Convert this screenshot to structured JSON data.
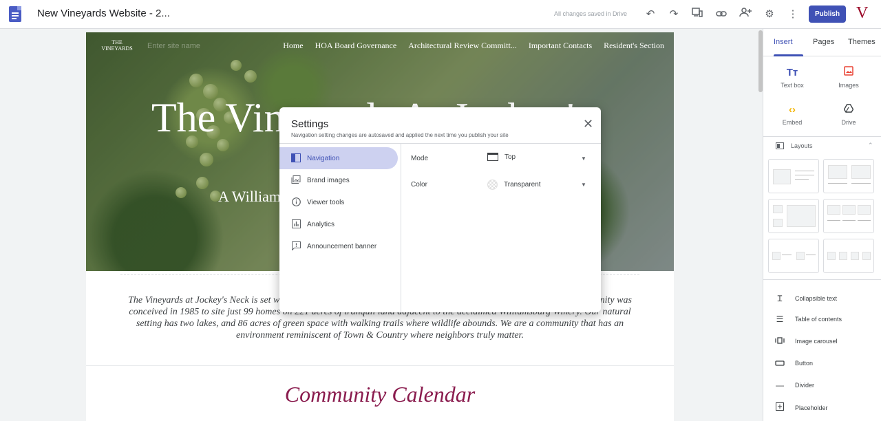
{
  "header": {
    "doc_title": "New Vineyards Website - 2...",
    "save_status": "All changes saved in Drive",
    "publish_label": "Publish",
    "account_initial": "V",
    "icons": [
      "undo-icon",
      "redo-icon",
      "preview-icon",
      "link-icon",
      "share-icon",
      "settings-icon",
      "more-icon"
    ]
  },
  "site": {
    "logo_text": "THE VINEYARDS",
    "name_placeholder": "Enter site name",
    "nav": [
      "Home",
      "HOA Board Governance",
      "Architectural Review Committ...",
      "Important Contacts",
      "Resident's Section"
    ],
    "hero_title": "The Vineyards At Jockey's",
    "hero_subtitle": "A Williamsburg Community",
    "intro": "The Vineyards at Jockey's Neck is set within a short distance from the restored area of Colonial Williamsburg. Our community was conceived in 1985 to site just 99 homes on 221 acres of tranquil land adjacent to the acclaimed Williamsburg Winery. Our natural setting has two lakes, and 86 acres of green space with walking trails where wildlife abounds. We are a community that has an environment reminiscent of Town & Country where neighbors truly matter.",
    "section_title": "Community Calendar"
  },
  "panel": {
    "tabs": [
      "Insert",
      "Pages",
      "Themes"
    ],
    "insert_items": [
      {
        "label": "Text box",
        "icon": "text-box-icon",
        "color": "#3f51b5"
      },
      {
        "label": "Images",
        "icon": "image-icon",
        "color": "#ea4335"
      },
      {
        "label": "Embed",
        "icon": "embed-icon",
        "color": "#f4b400"
      },
      {
        "label": "Drive",
        "icon": "drive-icon",
        "color": "#3c4043"
      }
    ],
    "layouts_label": "Layouts",
    "components": [
      {
        "label": "Collapsible text",
        "icon": "collapsible-text-icon"
      },
      {
        "label": "Table of contents",
        "icon": "table-of-contents-icon"
      },
      {
        "label": "Image carousel",
        "icon": "image-carousel-icon"
      },
      {
        "label": "Button",
        "icon": "button-icon"
      },
      {
        "label": "Divider",
        "icon": "divider-icon"
      },
      {
        "label": "Placeholder",
        "icon": "placeholder-icon"
      }
    ]
  },
  "dialog": {
    "title": "Settings",
    "subtitle": "Navigation setting changes are autosaved and applied the next time you publish your site",
    "nav": [
      "Navigation",
      "Brand images",
      "Viewer tools",
      "Analytics",
      "Announcement banner"
    ],
    "options": [
      {
        "label": "Mode",
        "value": "Top"
      },
      {
        "label": "Color",
        "value": "Transparent"
      }
    ]
  },
  "colors": {
    "accent": "#3f51b5",
    "brand": "#9c0b2a",
    "calendar_title": "#8a1c4e"
  }
}
